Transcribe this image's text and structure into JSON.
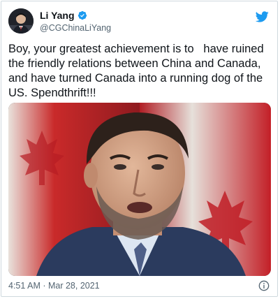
{
  "author": {
    "display_name": "Li Yang",
    "handle": "@CGChinaLiYang",
    "verified": true,
    "avatar_icon": "person-avatar"
  },
  "tweet": {
    "text": "Boy, your greatest achievement is to   have ruined the friendly relations between China and Canada, and have turned Canada into a running dog of the US. Spendthrift!!!",
    "timestamp": "4:51 AM · Mar 28, 2021"
  },
  "icons": {
    "verified": "verified-badge-icon",
    "brand": "twitter-bird-icon",
    "info": "info-icon"
  },
  "colors": {
    "brand_blue": "#1d9bf0",
    "text_primary": "#0f1419",
    "text_secondary": "#536471",
    "flag_red": "#c8102e"
  }
}
